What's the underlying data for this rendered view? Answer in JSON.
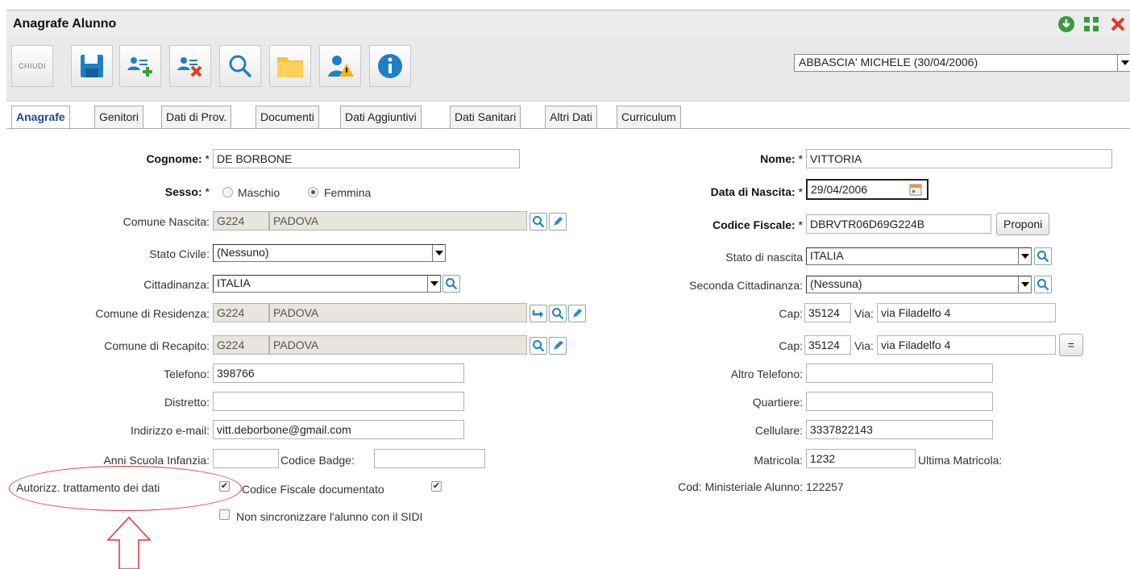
{
  "window": {
    "title": "Anagrafe Alunno"
  },
  "toolbar": {
    "close_label": "CHIUDI"
  },
  "student_selector": {
    "value": "ABBASCIA' MICHELE (30/04/2006)"
  },
  "tabs": [
    {
      "label": "Anagrafe"
    },
    {
      "label": "Genitori"
    },
    {
      "label": "Dati di Prov."
    },
    {
      "label": "Documenti"
    },
    {
      "label": "Dati Aggiuntivi"
    },
    {
      "label": "Dati Sanitari"
    },
    {
      "label": "Altri Dati"
    },
    {
      "label": "Curriculum"
    }
  ],
  "form": {
    "cognome": {
      "label": "Cognome:",
      "req": "*",
      "value": "DE BORBONE"
    },
    "nome": {
      "label": "Nome:",
      "req": "*",
      "value": "VITTORIA"
    },
    "sesso": {
      "label": "Sesso:",
      "req": "*",
      "opt1": "Maschio",
      "opt2": "Femmina"
    },
    "data_nascita": {
      "label": "Data di Nascita:",
      "req": "*",
      "value": "29/04/2006"
    },
    "comune_nascita": {
      "label": "Comune Nascita:",
      "code": "G224",
      "name": "PADOVA"
    },
    "codice_fiscale": {
      "label": "Codice Fiscale:",
      "req": "*",
      "value": "DBRVTR06D69G224B",
      "button": "Proponi"
    },
    "stato_civile": {
      "label": "Stato Civile:",
      "value": "(Nessuno)"
    },
    "stato_nascita": {
      "label": "Stato di nascita",
      "value": "ITALIA"
    },
    "cittadinanza": {
      "label": "Cittadinanza:",
      "value": "ITALIA"
    },
    "seconda_cittadinanza": {
      "label": "Seconda Cittadinanza:",
      "value": "(Nessuna)"
    },
    "comune_residenza": {
      "label": "Comune di Residenza:",
      "code": "G224",
      "name": "PADOVA"
    },
    "cap_residenza": {
      "cap_label": "Cap:",
      "cap": "35124",
      "via_label": "Via:",
      "via": "via Filadelfo 4"
    },
    "comune_recapito": {
      "label": "Comune di Recapito:",
      "code": "G224",
      "name": "PADOVA"
    },
    "cap_recapito": {
      "cap_label": "Cap:",
      "cap": "35124",
      "via_label": "Via:",
      "via": "via Filadelfo 4",
      "copy_button": "="
    },
    "telefono": {
      "label": "Telefono:",
      "value": "398766"
    },
    "altro_telefono": {
      "label": "Altro Telefono:",
      "value": ""
    },
    "distretto": {
      "label": "Distretto:",
      "value": ""
    },
    "quartiere": {
      "label": "Quartiere:",
      "value": ""
    },
    "email": {
      "label": "Indirizzo e-mail:",
      "value": "vitt.deborbone@gmail.com"
    },
    "cellulare": {
      "label": "Cellulare:",
      "value": "3337822143"
    },
    "anni_infanzia": {
      "label": "Anni Scuola Infanzia:",
      "value": ""
    },
    "codice_badge": {
      "label": "Codice Badge:",
      "value": ""
    },
    "matricola": {
      "label": "Matricola:",
      "value": "1232",
      "ultima_label": "Ultima Matricola:"
    },
    "autorizz": {
      "label": "Autorizz. trattamento dei dati"
    },
    "cf_documentato": {
      "label": "Codice Fiscale documentato"
    },
    "cod_ministeriale": {
      "label": "Cod: Ministeriale Alunno:",
      "value": "122257"
    },
    "non_sincronizzare": {
      "label": "Non sincronizzare l'alunno con il SIDI"
    }
  },
  "colors": {
    "accent": "#174a99",
    "annotation": "#d9353a",
    "toolbar_blue": "#1f7fc4"
  }
}
